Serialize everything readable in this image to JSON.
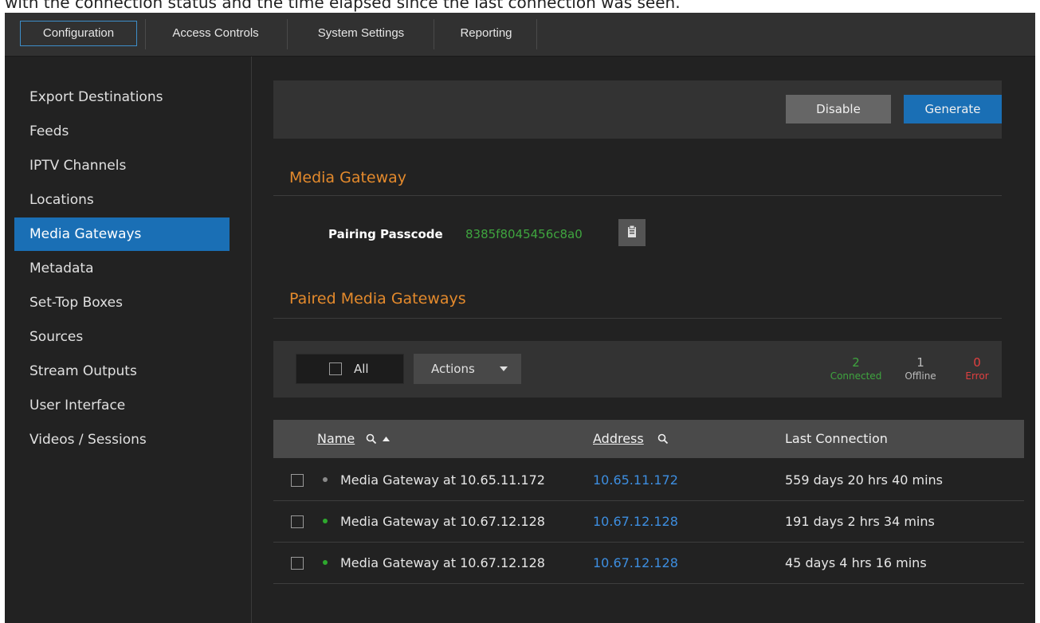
{
  "caption": "with the connection status and the time elapsed since the last connection was seen.",
  "topnav": {
    "tabs": [
      {
        "label": "Configuration",
        "active": true
      },
      {
        "label": "Access Controls",
        "active": false
      },
      {
        "label": "System Settings",
        "active": false
      },
      {
        "label": "Reporting",
        "active": false
      }
    ]
  },
  "sidebar": {
    "items": [
      {
        "label": "Export Destinations"
      },
      {
        "label": "Feeds"
      },
      {
        "label": "IPTV Channels"
      },
      {
        "label": "Locations"
      },
      {
        "label": "Media Gateways",
        "active": true
      },
      {
        "label": "Metadata"
      },
      {
        "label": "Set-Top Boxes"
      },
      {
        "label": "Sources"
      },
      {
        "label": "Stream Outputs"
      },
      {
        "label": "User Interface"
      },
      {
        "label": "Videos / Sessions"
      }
    ]
  },
  "toolbar": {
    "disable_label": "Disable",
    "generate_label": "Generate"
  },
  "media_gateway": {
    "title": "Media Gateway",
    "passcode_label": "Pairing Passcode",
    "passcode_value": "8385f8045456c8a0",
    "copy_icon": "clipboard-icon"
  },
  "paired": {
    "title": "Paired Media Gateways",
    "select_all_label": "All",
    "actions_label": "Actions",
    "stats": {
      "connected": {
        "value": "2",
        "label": "Connected"
      },
      "offline": {
        "value": "1",
        "label": "Offline"
      },
      "error": {
        "value": "0",
        "label": "Error"
      }
    },
    "columns": {
      "name": "Name",
      "address": "Address",
      "last_connection": "Last Connection"
    },
    "rows": [
      {
        "name": "Media Gateway at 10.65.11.172",
        "address": "10.65.11.172",
        "last_connection": "559 days 20 hrs 40 mins",
        "status": "offline"
      },
      {
        "name": "Media Gateway at 10.67.12.128",
        "address": "10.67.12.128",
        "last_connection": "191 days 2 hrs 34 mins",
        "status": "connected"
      },
      {
        "name": "Media Gateway at 10.67.12.128",
        "address": "10.67.12.128",
        "last_connection": "45 days 4 hrs 16 mins",
        "status": "connected"
      }
    ]
  },
  "colors": {
    "accent": "#1a6fb5",
    "section_title": "#e48a2c",
    "connected": "#3fa53f",
    "offline": "#9a9a9a",
    "error": "#e04040",
    "link": "#3d8ee0"
  }
}
